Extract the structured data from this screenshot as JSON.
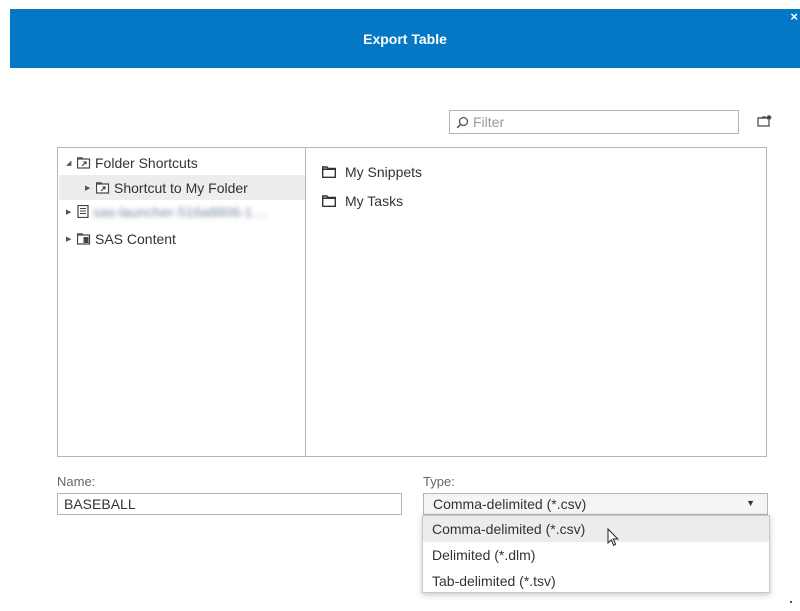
{
  "dialog": {
    "title": "Export Table",
    "close_label": "×"
  },
  "filter": {
    "placeholder": "Filter"
  },
  "icons": {
    "search": "search-icon",
    "new_folder": "new-folder-icon",
    "folder_shortcut": "folder-shortcut-icon",
    "server": "server-icon",
    "sas_content": "sas-content-icon",
    "folder": "folder-icon"
  },
  "tree": {
    "items": [
      {
        "label": "Folder Shortcuts",
        "expanded": true
      },
      {
        "label": "Shortcut to My Folder",
        "expanded": false,
        "selected": true
      },
      {
        "label": "sas-launcher-516a8806-1…",
        "expanded": false,
        "obscured": true
      },
      {
        "label": "SAS Content",
        "expanded": false
      }
    ]
  },
  "content": {
    "items": [
      {
        "label": "My Snippets"
      },
      {
        "label": "My Tasks"
      }
    ]
  },
  "name_field": {
    "label": "Name:",
    "value": "BASEBALL"
  },
  "type_field": {
    "label": "Type:",
    "selected": "Comma-delimited (*.csv)",
    "arrow": "▼",
    "options": [
      {
        "label": "Comma-delimited (*.csv)",
        "hovered": true
      },
      {
        "label": "Delimited (*.dlm)"
      },
      {
        "label": "Tab-delimited (*.tsv)"
      }
    ]
  },
  "colors": {
    "header_bg": "#0478c5",
    "border": "#b5b5b5",
    "selection_bg": "#ededed"
  }
}
